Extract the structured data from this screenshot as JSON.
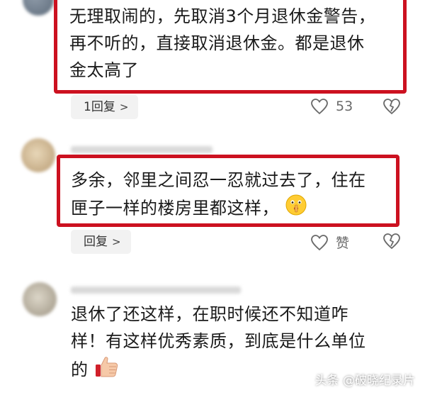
{
  "comments": [
    {
      "text": "无理取闹的，先取消3个月退休金警告，再不听的，直接取消退休金。都是退休金太高了",
      "lines": [
        "无理取闹的，先取消3个月退休金警告，",
        "再不听的，直接取消退休金。都是退休",
        "金太高了"
      ],
      "reply_label": "1回复",
      "like_count": "53"
    },
    {
      "text": "多余，邻里之间忍一忍就过去了，住在匣子一样的楼房里都这样，",
      "lines": [
        "多余，邻里之间忍一忍就过去了，住在",
        "匣子一样的楼房里都这样，"
      ],
      "reply_label": "回复",
      "like_label": "赞",
      "emoji": "shush-face-icon"
    },
    {
      "text": "退休了还这样，在职时候还不知道咋样！有这样优秀素质，到底是什么单位的",
      "lines": [
        "退休了还这样，在职时候还不知道咋",
        "样！有这样优秀素质，到底是什么单位",
        "的"
      ],
      "emoji": "thumbs-up-icon"
    }
  ],
  "watermark": "头条 @破晓纪录片",
  "colors": {
    "highlight": "#cc1120",
    "pill_bg": "#f2f2f2",
    "icon_gray": "#6a6a6a"
  }
}
